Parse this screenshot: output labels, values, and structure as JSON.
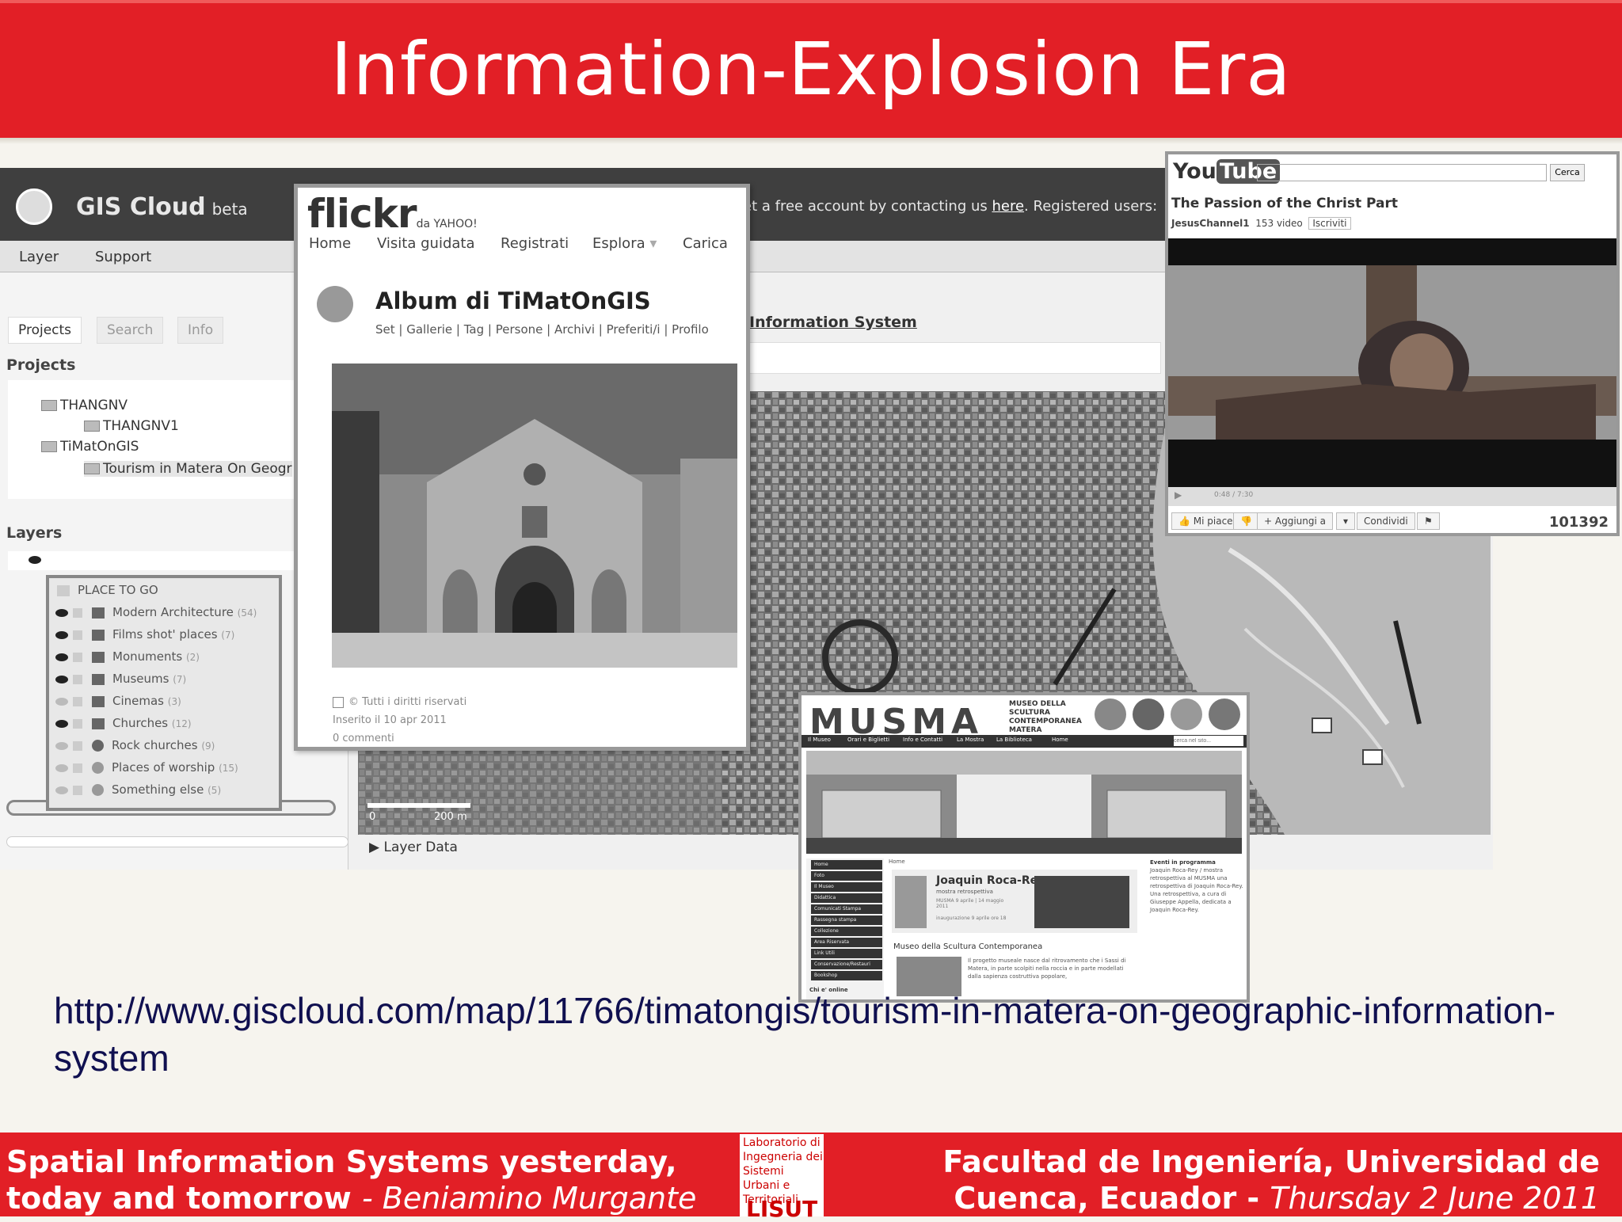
{
  "slide": {
    "title": "Information-Explosion Era"
  },
  "gis": {
    "brand": "GIS Cloud",
    "brand_tag": "beta",
    "top_message_pre": "et a free account by contacting us ",
    "top_message_link": "here",
    "top_message_post": ".   Registered users:",
    "menu": [
      "Layer",
      "Support"
    ],
    "tabs": [
      "Projects",
      "Search",
      "Info"
    ],
    "projects_heading": "Projects",
    "tree": [
      "THANGNV",
      "THANGNV1",
      "TiMatOnGIS",
      "Tourism in Matera On Geogr"
    ],
    "layers_heading": "Layers",
    "layer_group": "PLACE TO GO",
    "layers": [
      {
        "name": "Modern Architecture",
        "count": "(54)"
      },
      {
        "name": "Films shot' places",
        "count": "(7)"
      },
      {
        "name": "Monuments",
        "count": "(2)"
      },
      {
        "name": "Museums",
        "count": "(7)"
      },
      {
        "name": "Cinemas",
        "count": "(3)"
      },
      {
        "name": "Churches",
        "count": "(12)"
      },
      {
        "name": "Rock churches",
        "count": "(9)"
      },
      {
        "name": "Places of worship",
        "count": "(15)"
      },
      {
        "name": "Something else",
        "count": "(5)"
      }
    ],
    "map_title": "Information System",
    "scale_zero": "0",
    "scale_dist": "200 m",
    "layer_data": "Layer Data"
  },
  "flickr": {
    "logo": "flickr",
    "logo_sub": "da YAHOO!",
    "nav": [
      "Home",
      "Visita guidata",
      "Registrati",
      "Esplora",
      "Carica"
    ],
    "album_title": "Album di TiMatOnGIS",
    "album_sub": "Set | Gallerie | Tag | Persone | Archivi | Preferiti/i | Profilo",
    "rights": "Tutti i diritti riservati",
    "uploaded": "Inserito il 10 apr 2011",
    "comments": "0 commenti"
  },
  "youtube": {
    "logo_you": "You",
    "logo_tube": "Tube",
    "search_button": "Cerca",
    "video_title": "The Passion of the Christ Part",
    "channel": "JesusChannel1",
    "video_count": "153 video",
    "subscribe": "Iscriviti",
    "time": "0:48 / 7:30",
    "like": "Mi piace",
    "add": "+ Aggiungi a",
    "share": "Condividi",
    "views": "101392"
  },
  "musma": {
    "logo": "MUSMA",
    "subtitle": "MUSEO DELLA SCULTURA CONTEMPORANEA MATERA",
    "nav": [
      "Il Museo",
      "Orari e Biglietti",
      "Info e Contatti",
      "La Mostra",
      "La Biblioteca",
      "Home"
    ],
    "search_placeholder": "cerca nel sito...",
    "side": [
      "Home",
      "Foto",
      "Il Museo",
      "Didattica",
      "Comunicati Stampa",
      "Rassegna stampa",
      "Collezione",
      "Area Riservata",
      "Link Utili",
      "Conservazione/Restauri",
      "Bookshop"
    ],
    "side_footer": "Chi e' online",
    "breadcrumb": "Home",
    "feature_name": "Joaquin Roca-Rey",
    "feature_sub": "mostra retrospettiva",
    "feature_dates": "MUSMA 9 aprile | 14 maggio 2011",
    "feature_note": "inaugurazione 9 aprile ore 18",
    "section": "Museo della Scultura Contemporanea",
    "body": "Il progetto museale nasce dal ritrovamento che i Sassi di Matera, in parte scolpiti nella roccia e in parte modellati dalla sapienza costruttiva popolare,",
    "right_head": "Eventi in programma",
    "right_body": "Joaquin Roca-Rey / mostra retrospettiva al MUSMA una retrospettiva di Joaquin Roca-Rey. Una retrospettiva, a cura di Giuseppe Appella, dedicata a Joaquin Roca-Rey."
  },
  "url": "http://www.giscloud.com/map/11766/timatongis/tourism-in-matera-on-geographic-information-system",
  "footer": {
    "left_main": "Spatial Information Systems yesterday, today and tomorrow",
    "left_author": "- Beniamino Murgante",
    "right_main": "Facultad de Ingeniería, Universidad de Cuenca, Ecuador -",
    "right_date": "Thursday 2 June 2011",
    "lab": "Laboratorio di Ingegneria dei Sistemi Urbani e Territoriali",
    "lab_mark": "LISUT"
  }
}
